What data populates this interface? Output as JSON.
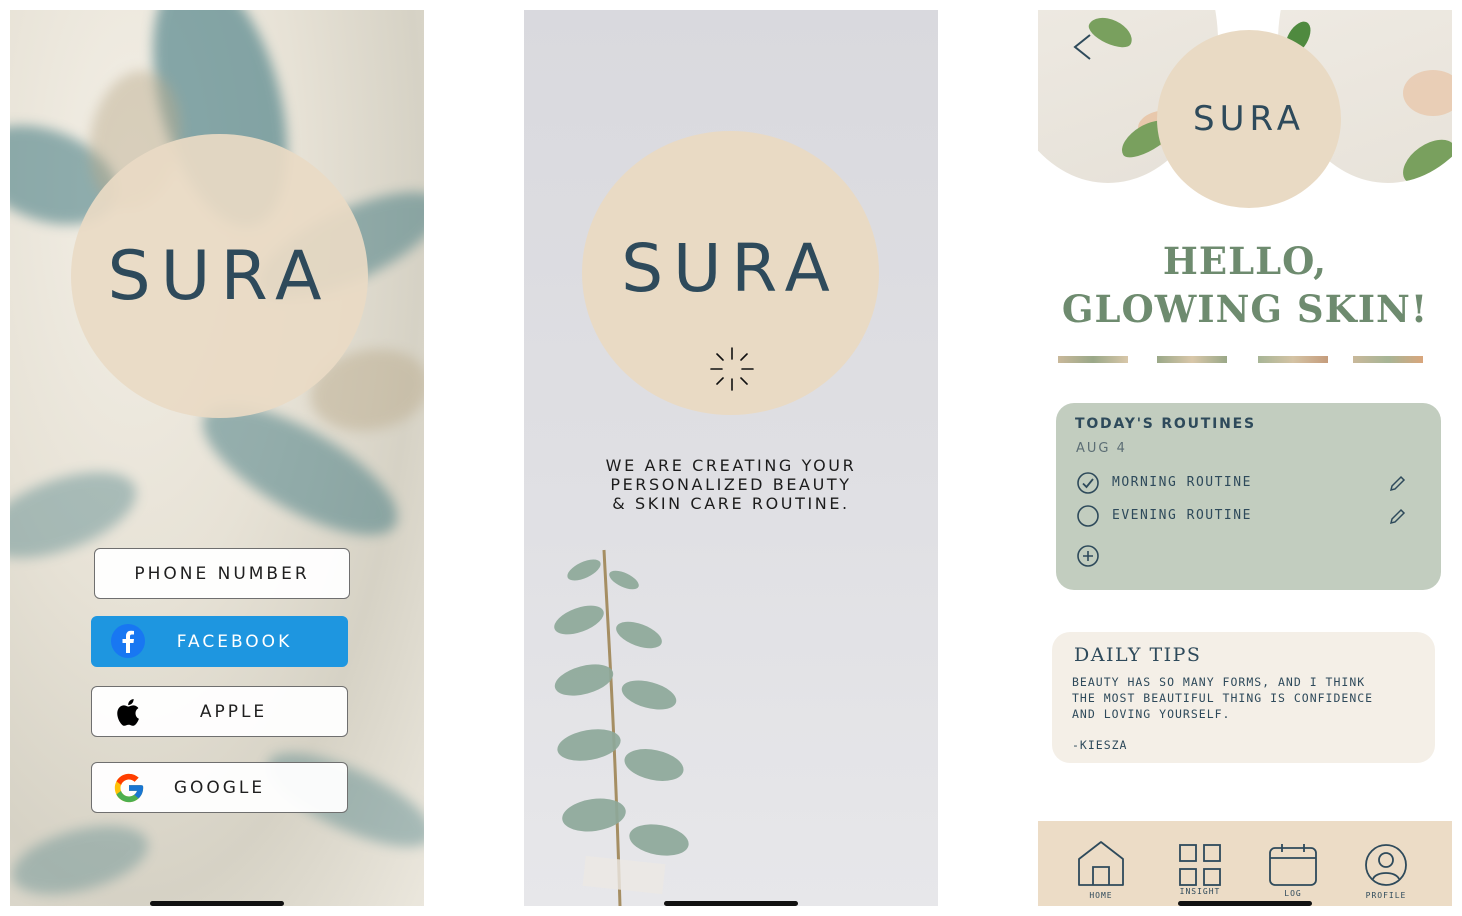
{
  "login": {
    "logo": "SURA",
    "phone_label": "PHONE NUMBER",
    "facebook_label": "FACEBOOK",
    "apple_label": "APPLE",
    "google_label": "GOOGLE"
  },
  "loading": {
    "logo": "SURA",
    "message_line1": "WE ARE CREATING YOUR",
    "message_line2": "PERSONALIZED BEAUTY",
    "message_line3": "& SKIN CARE ROUTINE."
  },
  "home": {
    "back_glyph": "<",
    "logo": "SURA",
    "greeting_line1": "HELLO,",
    "greeting_line2": "GLOWING SKIN!",
    "routines": {
      "title": "TODAY'S ROUTINES",
      "date": "AUG 4",
      "items": [
        {
          "label": "MORNING ROUTINE",
          "done": true
        },
        {
          "label": "EVENING ROUTINE",
          "done": false
        }
      ]
    },
    "tips": {
      "title": "DAILY TIPS",
      "body_line1": "BEAUTY HAS SO MANY FORMS, AND I THINK",
      "body_line2": "THE MOST BEAUTIFUL THING IS CONFIDENCE",
      "body_line3": "AND LOVING YOURSELF.",
      "author": "-KIESZA"
    },
    "tabs": [
      {
        "label": "HOME",
        "icon": "house-icon"
      },
      {
        "label": "INSIGHT",
        "icon": "grid-icon"
      },
      {
        "label": "LOG",
        "icon": "calendar-icon"
      },
      {
        "label": "PROFILE",
        "icon": "user-icon"
      }
    ]
  },
  "colors": {
    "navy": "#2e4a5b",
    "beige": "#e9dac4",
    "sage": "#c2cdbf",
    "green_heading": "#6e8b6f",
    "facebook_blue": "#1e96e0",
    "tips_bg": "#f4efe7"
  }
}
